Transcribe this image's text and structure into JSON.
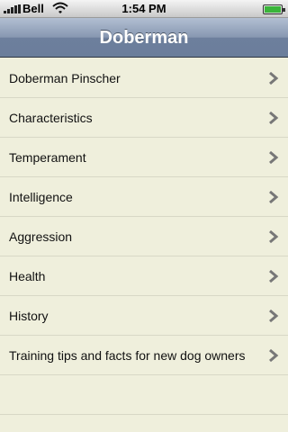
{
  "status_bar": {
    "carrier": "Bell",
    "time": "1:54 PM",
    "icons": [
      "signal-icon",
      "wifi-icon",
      "battery-icon"
    ]
  },
  "nav": {
    "title": "Doberman"
  },
  "list": {
    "items": [
      {
        "label": "Doberman Pinscher"
      },
      {
        "label": "Characteristics"
      },
      {
        "label": "Temperament"
      },
      {
        "label": "Intelligence"
      },
      {
        "label": "Aggression"
      },
      {
        "label": "Health"
      },
      {
        "label": "History"
      },
      {
        "label": "Training tips and facts for new dog owners"
      }
    ]
  },
  "colors": {
    "background": "#efefdc",
    "nav_bar": "#8797b1",
    "chevron": "#777777",
    "separator": "#d8d8c6"
  }
}
